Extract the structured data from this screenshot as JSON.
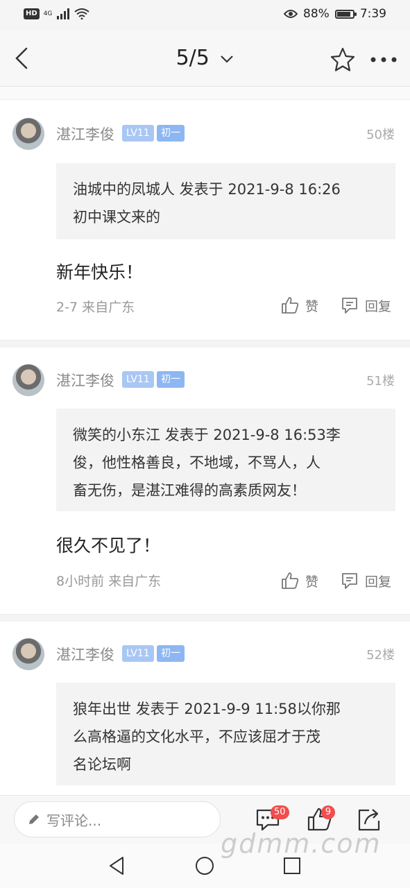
{
  "status_bar": {
    "hd": "HD",
    "network": "4G",
    "battery_pct_text": "88%",
    "battery_level": 0.88,
    "time": "7:39"
  },
  "nav": {
    "page_indicator": "5/5",
    "icons": [
      "back-icon",
      "chevron-down-icon",
      "star-icon",
      "more-icon"
    ]
  },
  "posts": [
    {
      "username": "湛江李俊",
      "level": "LV11",
      "rank": "初一",
      "floor": "50楼",
      "quote_line1": "油城中的凤城人 发表于 2021-9-8 16:26",
      "quote_line2": "初中课文来的",
      "content": "新年快乐！",
      "meta": "2-7 来自广东",
      "like_label": "赞",
      "reply_label": "回复"
    },
    {
      "username": "湛江李俊",
      "level": "LV11",
      "rank": "初一",
      "floor": "51楼",
      "quote_line1": "微笑的小东江 发表于 2021-9-8 16:53李",
      "quote_line2": "俊，他性格善良，不地域，不骂人，人",
      "quote_line3": "畜无伤，是湛江难得的高素质网友！",
      "content": "很久不见了！",
      "meta": "8小时前 来自广东",
      "like_label": "赞",
      "reply_label": "回复"
    },
    {
      "username": "湛江李俊",
      "level": "LV11",
      "rank": "初一",
      "floor": "52楼",
      "quote_line1": "狼年出世 发表于 2021-9-9 11:58以你那",
      "quote_line2": "么高格逼的文化水平，不应该屈才于茂",
      "quote_line3": "名论坛啊"
    }
  ],
  "comment_bar": {
    "placeholder": "写评论...",
    "comment_count": "50",
    "like_count": "9"
  },
  "watermark": "gdmm.com",
  "colors": {
    "badge_red": "#f24d4d",
    "level_badge": "#a9c7f4",
    "rank_badge": "#8db7f2"
  }
}
